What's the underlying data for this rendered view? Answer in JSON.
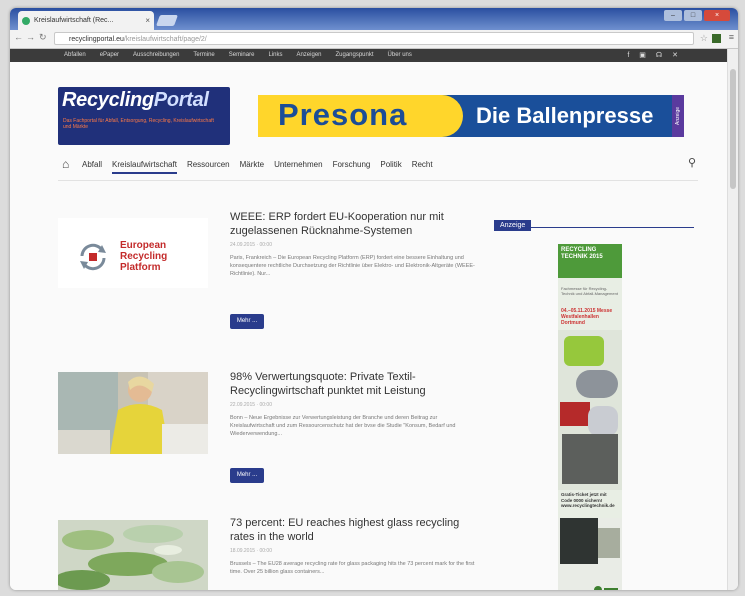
{
  "browser": {
    "tab_title": "Kreislaufwirtschaft (Rec...",
    "tab_close": "×",
    "url_host": "recyclingportal.eu",
    "url_path": "/kreislaufwirtschaft/page/2/",
    "window_controls": [
      "–",
      "□",
      "×"
    ]
  },
  "topnav": {
    "links": [
      "Abfallen",
      "ePaper",
      "Ausschreibungen",
      "Termine",
      "Seminare",
      "Links",
      "Anzeigen",
      "Zugangspunkt",
      "Über uns"
    ],
    "social": [
      "f",
      "▣",
      "☊",
      "✕"
    ]
  },
  "logo": {
    "recycling": "Recycling",
    "portal": "Portal",
    "tagline": "Das Fachportal für Abfall, Entsorgung, Recycling, Kreislaufwirtschaft und Märkte"
  },
  "banner": {
    "brand": "Presona",
    "slogan": "Die Ballenpresse",
    "tag": "Anzeige"
  },
  "mainnav": {
    "items": [
      "Abfall",
      "Kreislaufwirtschaft",
      "Ressourcen",
      "Märkte",
      "Unternehmen",
      "Forschung",
      "Politik",
      "Recht"
    ]
  },
  "articles": [
    {
      "title": "WEEE: ERP fordert EU-Kooperation nur mit zugelassenen Rücknahme-Systemen",
      "date": "24.09.2015 · 00:00",
      "excerpt": "Paris, Frankreich – Die European Recycling Platform (ERP) fordert eine bessere Einhaltung und konsequentere rechtliche Durchsetzung der Richtlinie über Elektro- und Elektronik-Altgeräte (WEEE-Richtlinie). Nur...",
      "more": "Mehr ...",
      "logo_lines": [
        "European",
        "Recycling",
        "Platform"
      ]
    },
    {
      "title": "98% Verwertungsquote: Private Textil-Recyclingwirtschaft punktet mit Leistung",
      "date": "22.09.2015 · 00:00",
      "excerpt": "Bonn – Neue Ergebnisse zur Verwertungsleistung der Branche und deren Beitrag zur Kreislaufwirtschaft und zum Ressourcenschutz hat der bvse die Studie \"Konsum, Bedarf und Wiederverwendung...",
      "more": "Mehr ..."
    },
    {
      "title": "73 percent: EU reaches highest glass recycling rates in the world",
      "date": "18.09.2015 · 00:00",
      "excerpt": "Brussels – The EU28 average recycling rate for glass packaging hits the 73 percent mark for the first time. Over 25 billion glass containers..."
    }
  ],
  "sidebar": {
    "heading": "Anzeige",
    "ad_title": "RECYCLING TECHNIK 2015",
    "ad_small": "Fachmesse für Recycling-Technik und Abfall-Management",
    "ad_dates": "04.–05.11.2015 Messe Westfalenhallen Dortmund",
    "ad_cta": "Gratis-Ticket jetzt mit Code 0000 sichern! www.recyclingtechnik.de"
  },
  "colors": {
    "accent": "#2a3c8c",
    "banner_yellow": "#ffd62b",
    "banner_blue": "#1a4f9a",
    "erp_red": "#c32b2b"
  }
}
